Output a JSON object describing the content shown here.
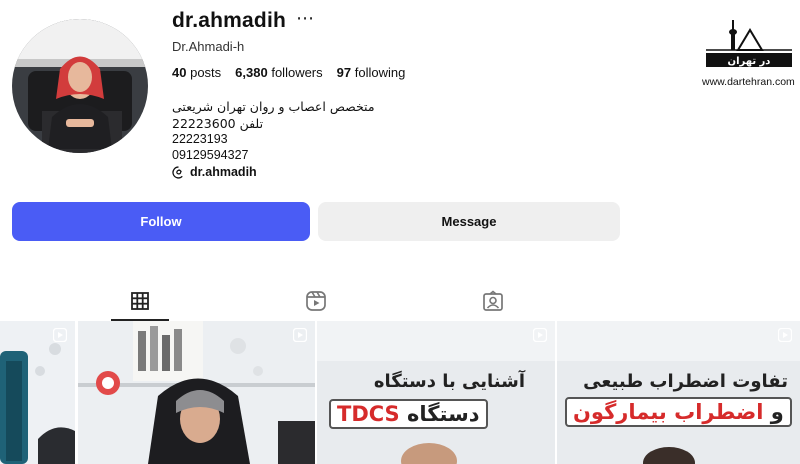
{
  "profile": {
    "username": "dr.ahmadih",
    "full_name": "Dr.Ahmadi-h",
    "stats": {
      "posts": "40",
      "posts_label": "posts",
      "followers": "6,380",
      "followers_label": "followers",
      "following": "97",
      "following_label": "following"
    },
    "bio": [
      "متخصص اعصاب و روان تهران شریعتی",
      "تلفن 22223600",
      "22223193",
      "09129594327"
    ],
    "threads_handle": "dr.ahmadih",
    "more_icon": "⋯"
  },
  "buttons": {
    "follow": "Follow",
    "message": "Message"
  },
  "tabs": [
    {
      "name": "posts",
      "icon": "grid-icon",
      "active": true
    },
    {
      "name": "reels",
      "icon": "reels-icon",
      "active": false
    },
    {
      "name": "tagged",
      "icon": "tagged-icon",
      "active": false
    }
  ],
  "posts": {
    "post3": {
      "line1": "آشنایی با دستگاه",
      "line2_black": "دستگاه",
      "line2_red": "TDCS"
    },
    "post4": {
      "line1": "تفاوت اضطراب طبیعی",
      "line2_black": "و",
      "line2_red": "اضطراب بیمارگون"
    }
  },
  "watermark": {
    "logo_text": "در تهران",
    "url": "www.dartehran.com"
  },
  "colors": {
    "accent": "#4a5cf5",
    "secondary_button": "#efefef",
    "headline_red": "#d62b2b"
  }
}
